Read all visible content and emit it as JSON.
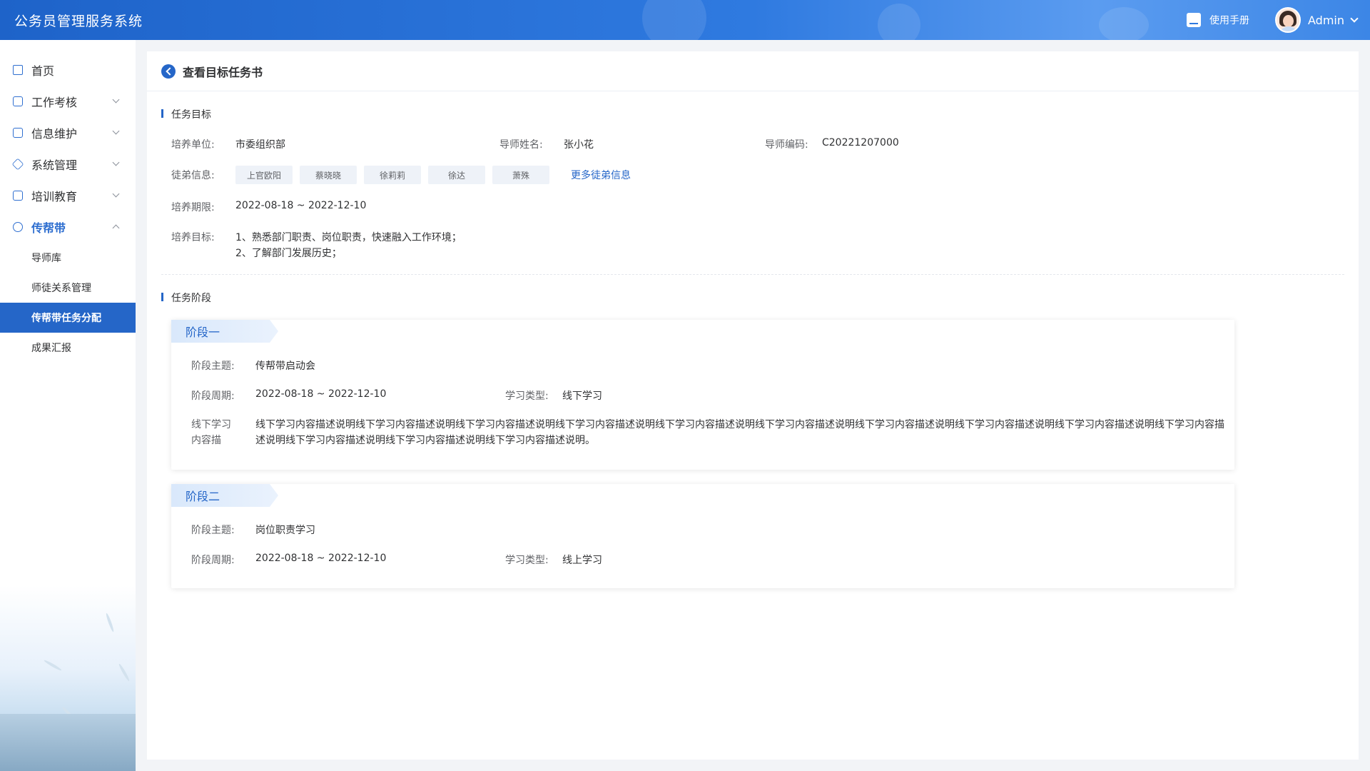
{
  "header": {
    "app_title": "公务员管理服务系统",
    "manual_label": "使用手册",
    "user_name": "Admin",
    "icons": {
      "manual": "book-icon",
      "user": "avatar",
      "dropdown": "chevron-down-icon"
    }
  },
  "sidebar": {
    "items": [
      {
        "label": "首页",
        "icon": "home-icon"
      },
      {
        "label": "工作考核",
        "icon": "clipboard-icon"
      },
      {
        "label": "信息维护",
        "icon": "monitor-icon"
      },
      {
        "label": "系统管理",
        "icon": "layers-icon"
      },
      {
        "label": "培训教育",
        "icon": "message-icon"
      },
      {
        "label": "传帮带",
        "icon": "people-icon"
      }
    ],
    "sub_items": [
      {
        "label": "导师库"
      },
      {
        "label": "师徒关系管理"
      },
      {
        "label": "传帮带任务分配"
      },
      {
        "label": "成果汇报"
      }
    ],
    "selected_sub": "传帮带任务分配"
  },
  "page": {
    "title": "查看目标任务书",
    "goal_section": {
      "title": "任务目标",
      "unit_label": "培养单位:",
      "unit_value": "市委组织部",
      "mentor_label": "导师姓名:",
      "mentor_value": "张小花",
      "code_label": "导师编码:",
      "code_value": "C20221207000",
      "apprentice_label": "徒弟信息:",
      "apprentices": [
        "上官欧阳",
        "蔡晓晓",
        "徐莉莉",
        "徐达",
        "萧殊"
      ],
      "more_link": "更多徒弟信息",
      "period_label": "培养期限:",
      "period_value": "2022-08-18 ~ 2022-12-10",
      "target_label": "培养目标:",
      "target_lines": [
        "1、熟悉部门职责、岗位职责，快速融入工作环境；",
        "2、了解部门发展历史；"
      ]
    },
    "stage_section": {
      "title": "任务阶段",
      "stages": [
        {
          "name": "阶段一",
          "theme_label": "阶段主题:",
          "theme_value": "传帮带启动会",
          "cycle_label": "阶段周期:",
          "cycle_value": "2022-08-18 ~ 2022-12-10",
          "type_label": "学习类型:",
          "type_value": "线下学习",
          "desc_label": "线下学习内容描",
          "desc_value": "线下学习内容描述说明线下学习内容描述说明线下学习内容描述说明线下学习内容描述说明线下学习内容描述说明线下学习内容描述说明线下学习内容描述说明线下学习内容描述说明线下学习内容描述说明线下学习内容描述说明线下学习内容描述说明线下学习内容描述说明线下学习内容描述说明。"
        },
        {
          "name": "阶段二",
          "theme_label": "阶段主题:",
          "theme_value": "岗位职责学习",
          "cycle_label": "阶段周期:",
          "cycle_value": "2022-08-18 ~ 2022-12-10",
          "type_label": "学习类型:",
          "type_value": "线上学习"
        }
      ]
    }
  },
  "colors": {
    "primary": "#2566c8",
    "header_gradient_start": "#1e63c9",
    "page_bg": "#f2f4f7"
  }
}
